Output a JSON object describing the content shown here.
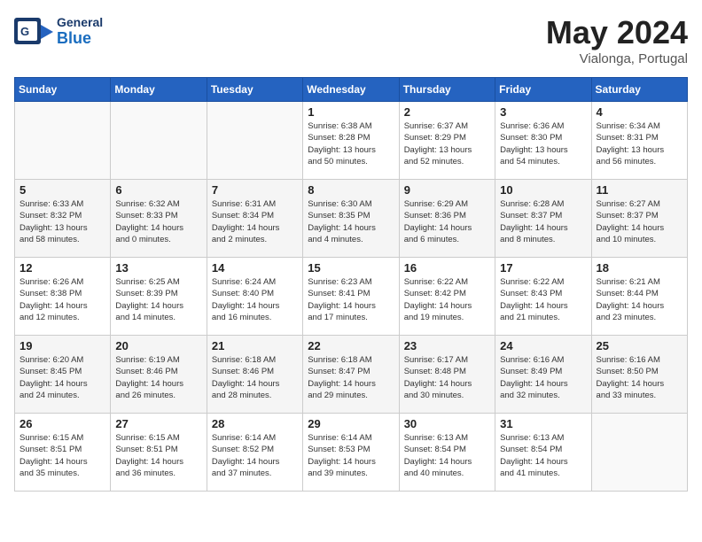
{
  "header": {
    "logo_general": "General",
    "logo_blue": "Blue",
    "month_year": "May 2024",
    "location": "Vialonga, Portugal"
  },
  "days_of_week": [
    "Sunday",
    "Monday",
    "Tuesday",
    "Wednesday",
    "Thursday",
    "Friday",
    "Saturday"
  ],
  "weeks": [
    [
      {
        "day": "",
        "info": ""
      },
      {
        "day": "",
        "info": ""
      },
      {
        "day": "",
        "info": ""
      },
      {
        "day": "1",
        "info": "Sunrise: 6:38 AM\nSunset: 8:28 PM\nDaylight: 13 hours\nand 50 minutes."
      },
      {
        "day": "2",
        "info": "Sunrise: 6:37 AM\nSunset: 8:29 PM\nDaylight: 13 hours\nand 52 minutes."
      },
      {
        "day": "3",
        "info": "Sunrise: 6:36 AM\nSunset: 8:30 PM\nDaylight: 13 hours\nand 54 minutes."
      },
      {
        "day": "4",
        "info": "Sunrise: 6:34 AM\nSunset: 8:31 PM\nDaylight: 13 hours\nand 56 minutes."
      }
    ],
    [
      {
        "day": "5",
        "info": "Sunrise: 6:33 AM\nSunset: 8:32 PM\nDaylight: 13 hours\nand 58 minutes."
      },
      {
        "day": "6",
        "info": "Sunrise: 6:32 AM\nSunset: 8:33 PM\nDaylight: 14 hours\nand 0 minutes."
      },
      {
        "day": "7",
        "info": "Sunrise: 6:31 AM\nSunset: 8:34 PM\nDaylight: 14 hours\nand 2 minutes."
      },
      {
        "day": "8",
        "info": "Sunrise: 6:30 AM\nSunset: 8:35 PM\nDaylight: 14 hours\nand 4 minutes."
      },
      {
        "day": "9",
        "info": "Sunrise: 6:29 AM\nSunset: 8:36 PM\nDaylight: 14 hours\nand 6 minutes."
      },
      {
        "day": "10",
        "info": "Sunrise: 6:28 AM\nSunset: 8:37 PM\nDaylight: 14 hours\nand 8 minutes."
      },
      {
        "day": "11",
        "info": "Sunrise: 6:27 AM\nSunset: 8:37 PM\nDaylight: 14 hours\nand 10 minutes."
      }
    ],
    [
      {
        "day": "12",
        "info": "Sunrise: 6:26 AM\nSunset: 8:38 PM\nDaylight: 14 hours\nand 12 minutes."
      },
      {
        "day": "13",
        "info": "Sunrise: 6:25 AM\nSunset: 8:39 PM\nDaylight: 14 hours\nand 14 minutes."
      },
      {
        "day": "14",
        "info": "Sunrise: 6:24 AM\nSunset: 8:40 PM\nDaylight: 14 hours\nand 16 minutes."
      },
      {
        "day": "15",
        "info": "Sunrise: 6:23 AM\nSunset: 8:41 PM\nDaylight: 14 hours\nand 17 minutes."
      },
      {
        "day": "16",
        "info": "Sunrise: 6:22 AM\nSunset: 8:42 PM\nDaylight: 14 hours\nand 19 minutes."
      },
      {
        "day": "17",
        "info": "Sunrise: 6:22 AM\nSunset: 8:43 PM\nDaylight: 14 hours\nand 21 minutes."
      },
      {
        "day": "18",
        "info": "Sunrise: 6:21 AM\nSunset: 8:44 PM\nDaylight: 14 hours\nand 23 minutes."
      }
    ],
    [
      {
        "day": "19",
        "info": "Sunrise: 6:20 AM\nSunset: 8:45 PM\nDaylight: 14 hours\nand 24 minutes."
      },
      {
        "day": "20",
        "info": "Sunrise: 6:19 AM\nSunset: 8:46 PM\nDaylight: 14 hours\nand 26 minutes."
      },
      {
        "day": "21",
        "info": "Sunrise: 6:18 AM\nSunset: 8:46 PM\nDaylight: 14 hours\nand 28 minutes."
      },
      {
        "day": "22",
        "info": "Sunrise: 6:18 AM\nSunset: 8:47 PM\nDaylight: 14 hours\nand 29 minutes."
      },
      {
        "day": "23",
        "info": "Sunrise: 6:17 AM\nSunset: 8:48 PM\nDaylight: 14 hours\nand 30 minutes."
      },
      {
        "day": "24",
        "info": "Sunrise: 6:16 AM\nSunset: 8:49 PM\nDaylight: 14 hours\nand 32 minutes."
      },
      {
        "day": "25",
        "info": "Sunrise: 6:16 AM\nSunset: 8:50 PM\nDaylight: 14 hours\nand 33 minutes."
      }
    ],
    [
      {
        "day": "26",
        "info": "Sunrise: 6:15 AM\nSunset: 8:51 PM\nDaylight: 14 hours\nand 35 minutes."
      },
      {
        "day": "27",
        "info": "Sunrise: 6:15 AM\nSunset: 8:51 PM\nDaylight: 14 hours\nand 36 minutes."
      },
      {
        "day": "28",
        "info": "Sunrise: 6:14 AM\nSunset: 8:52 PM\nDaylight: 14 hours\nand 37 minutes."
      },
      {
        "day": "29",
        "info": "Sunrise: 6:14 AM\nSunset: 8:53 PM\nDaylight: 14 hours\nand 39 minutes."
      },
      {
        "day": "30",
        "info": "Sunrise: 6:13 AM\nSunset: 8:54 PM\nDaylight: 14 hours\nand 40 minutes."
      },
      {
        "day": "31",
        "info": "Sunrise: 6:13 AM\nSunset: 8:54 PM\nDaylight: 14 hours\nand 41 minutes."
      },
      {
        "day": "",
        "info": ""
      }
    ]
  ]
}
